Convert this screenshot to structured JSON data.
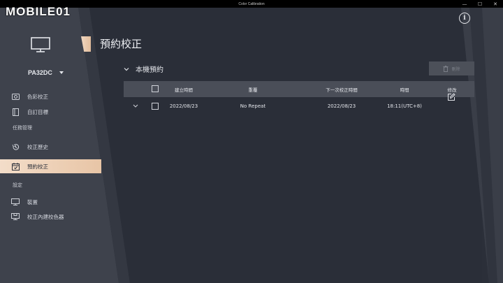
{
  "window": {
    "title": "Color Calibration",
    "controls": [
      "—",
      "☐",
      "✕"
    ]
  },
  "watermark": {
    "text": "MOBILE01"
  },
  "sidebar": {
    "device": {
      "name": "PA32DC",
      "icon": "monitor-icon"
    },
    "groups": [
      {
        "items": [
          {
            "label": "色彩校正",
            "icon": "color-calibration-icon"
          },
          {
            "label": "自訂目標",
            "icon": "custom-target-icon"
          }
        ]
      },
      {
        "heading": "任務管理",
        "items": [
          {
            "label": "校正歷史",
            "icon": "history-icon"
          },
          {
            "label": "預約校正",
            "icon": "calendar-icon",
            "active": true
          }
        ]
      },
      {
        "heading": "設定",
        "items": [
          {
            "label": "裝置",
            "icon": "device-icon"
          },
          {
            "label": "校正內建校色器",
            "icon": "builtin-calibrator-icon"
          }
        ]
      }
    ]
  },
  "main": {
    "page_title": "預約校正",
    "section_title": "本機預約",
    "delete_label": "刪除",
    "table": {
      "columns": [
        "建立時間",
        "重覆",
        "下一次校正時間",
        "時間",
        "修改"
      ],
      "rows": [
        {
          "created": "2022/08/23",
          "repeat": "No Repeat",
          "next": "2022/08/23",
          "time": "18:11(UTC+8)"
        }
      ]
    }
  },
  "colors": {
    "accent": "#e8c5a6",
    "background": "#2b2f39",
    "panel": "#3a3e48",
    "table_header": "#4a4e58"
  }
}
